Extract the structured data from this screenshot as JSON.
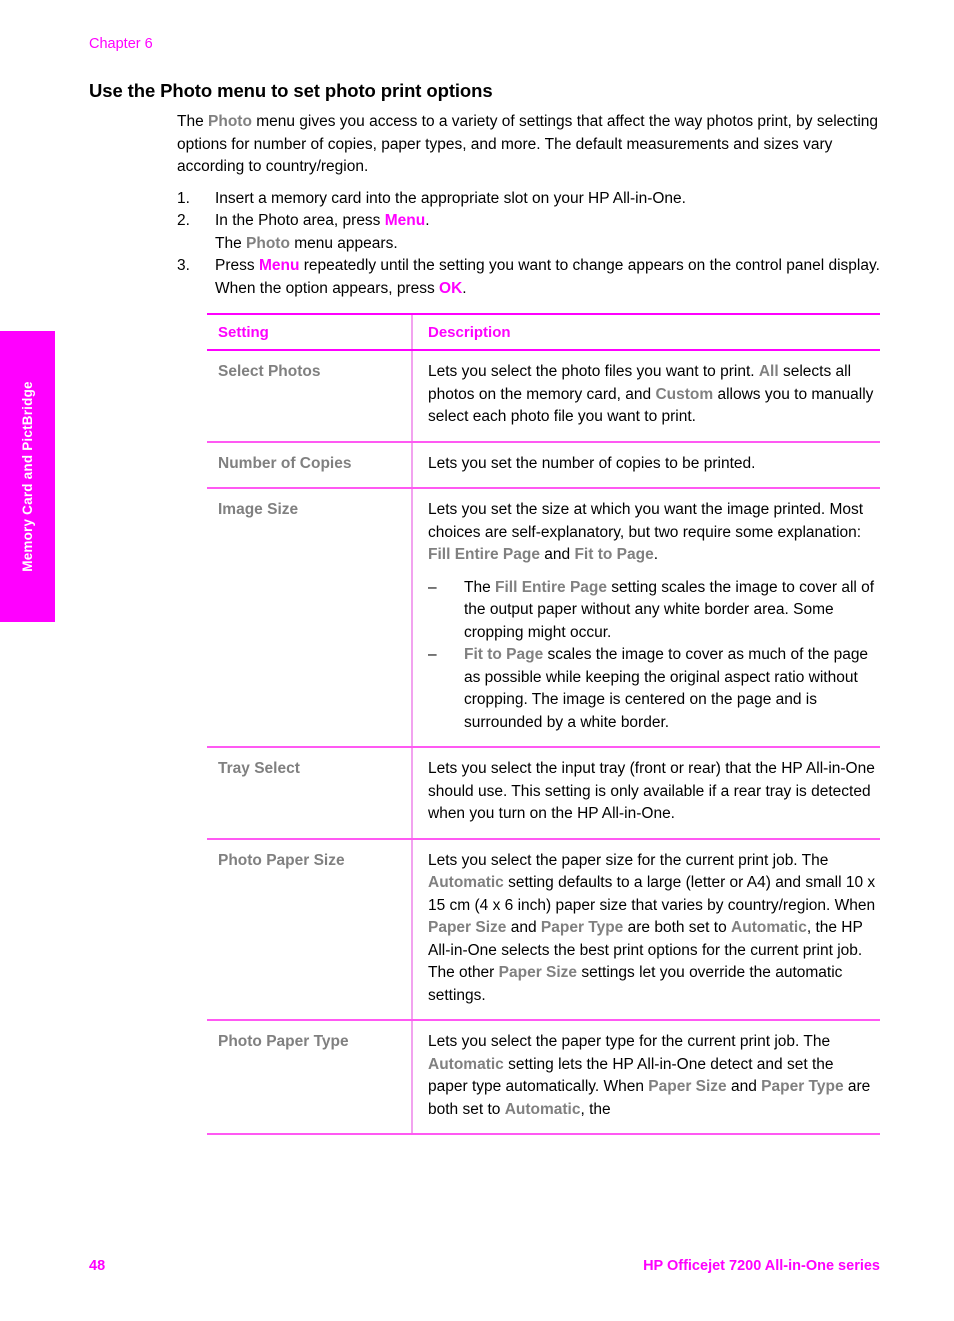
{
  "colors": {
    "magenta": "#ff00ff",
    "ui_term_gray": "#808080",
    "rule_magenta": "#ff59f3",
    "divider_pink": "#f2a3ef"
  },
  "side_tab": {
    "label": "Memory Card and PictBridge"
  },
  "header": {
    "chapter": "Chapter 6"
  },
  "section": {
    "heading": "Use the Photo menu to set photo print options",
    "intro": {
      "p1_a": "The ",
      "p1_term": "Photo",
      "p1_b": " menu gives you access to a variety of settings that affect the way photos print, by selecting options for number of copies, paper types, and more. The default measurements and sizes vary according to country/region."
    }
  },
  "steps": [
    {
      "num": "1.",
      "text": "Insert a memory card into the appropriate slot on your HP All-in-One."
    },
    {
      "num": "2.",
      "text_a": "In the Photo area, press ",
      "term": "Menu",
      "text_b": ".",
      "sub_a": "The ",
      "sub_term": "Photo",
      "sub_b": " menu appears."
    },
    {
      "num": "3.",
      "text_a": "Press ",
      "term1": "Menu",
      "text_b": " repeatedly until the setting you want to change appears on the control panel display. When the option appears, press ",
      "term2": "OK",
      "text_c": "."
    }
  ],
  "table": {
    "headers": {
      "setting": "Setting",
      "description": "Description"
    },
    "rows": [
      {
        "setting": "Select Photos",
        "desc": {
          "a": "Lets you select the photo files you want to print. ",
          "t1": "All",
          "b": " selects all photos on the memory card, and ",
          "t2": "Custom",
          "c": " allows you to manually select each photo file you want to print."
        }
      },
      {
        "setting": "Number of Copies",
        "desc": {
          "a": "Lets you set the number of copies to be printed."
        }
      },
      {
        "setting": "Image Size",
        "desc": {
          "a": "Lets you set the size at which you want the image printed. Most choices are self-explanatory, but two require some explanation: ",
          "t1": "Fill Entire Page",
          "b": " and ",
          "t2": "Fit to Page",
          "c": "."
        },
        "bullets": [
          {
            "dash": "–",
            "a": "The ",
            "t1": "Fill Entire Page",
            "b": " setting scales the image to cover all of the output paper without any white border area. Some cropping might occur."
          },
          {
            "dash": "–",
            "a": "",
            "t1": "Fit to Page",
            "b": " scales the image to cover as much of the page as possible while keeping the original aspect ratio without cropping. The image is centered on the page and is surrounded by a white border."
          }
        ]
      },
      {
        "setting": "Tray Select",
        "desc": {
          "a": "Lets you select the input tray (front or rear) that the HP All-in-One should use. This setting is only available if a rear tray is detected when you turn on the HP All-in-One."
        }
      },
      {
        "setting": "Photo Paper Size",
        "desc": {
          "a": "Lets you select the paper size for the current print job. The ",
          "t1": "Automatic",
          "b": " setting defaults to a large (letter or A4) and small 10 x 15 cm (4 x 6 inch) paper size that varies by country/region. When ",
          "t2": "Paper Size",
          "c": " and ",
          "t3": "Paper Type",
          "d": " are both set to ",
          "t4": "Automatic",
          "e": ", the HP All-in-One selects the best print options for the current print job. The other ",
          "t5": "Paper Size",
          "f": " settings let you override the automatic settings."
        }
      },
      {
        "setting": "Photo Paper Type",
        "desc": {
          "a": "Lets you select the paper type for the current print job. The ",
          "t1": "Automatic",
          "b": " setting lets the HP All-in-One detect and set the paper type automatically. When ",
          "t2": "Paper Size",
          "c": " and ",
          "t3": "Paper Type",
          "d": " are both set to ",
          "t4": "Automatic",
          "e": ", the"
        }
      }
    ]
  },
  "footer": {
    "page_number": "48",
    "product": "HP Officejet 7200 All-in-One series"
  }
}
